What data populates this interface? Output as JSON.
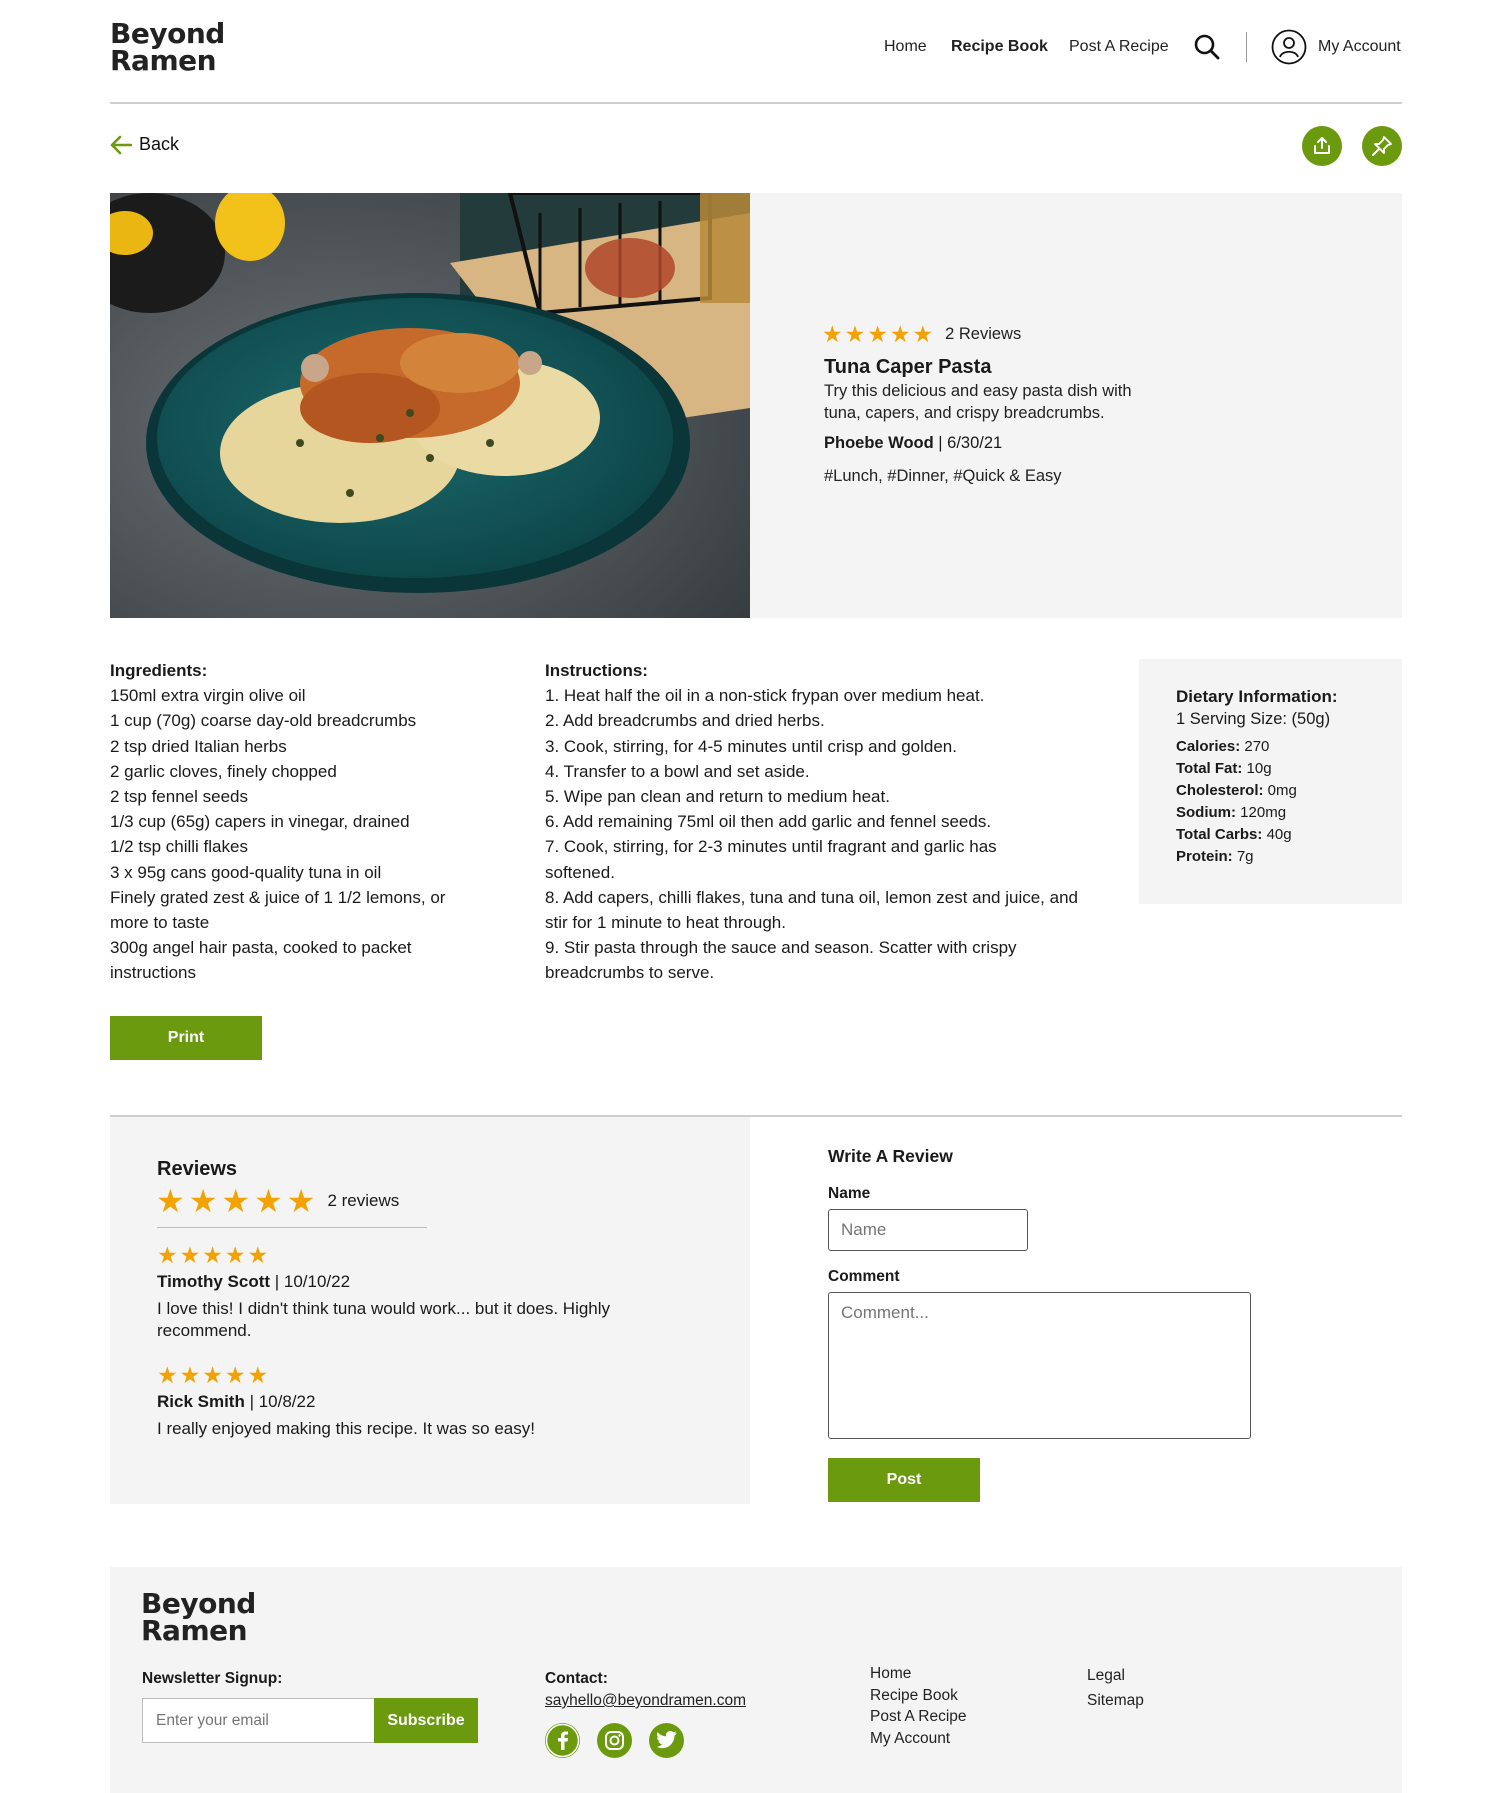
{
  "header": {
    "logo": [
      "Beyond",
      "Ramen"
    ],
    "nav": [
      "Home",
      "Recipe Book",
      "Post A Recipe"
    ],
    "account_label": "My Account"
  },
  "back_label": "Back",
  "recipe": {
    "image_alt": "Tuna caper pasta on a teal plate",
    "stars": "★★★★★",
    "rating": 5,
    "reviews_count": "2 Reviews",
    "title": "Tuna Caper Pasta",
    "description_lines": [
      "Try this delicious and easy pasta dish with",
      "tuna, capers, and crispy breadcrumbs."
    ],
    "author": "Phoebe Wood",
    "date": " | 6/30/21",
    "tags": "#Lunch, #Dinner, #Quick & Easy"
  },
  "ingredients": {
    "heading": "Ingredients:",
    "lines": [
      "150ml extra virgin olive oil",
      "1 cup (70g) coarse day-old breadcrumbs",
      "2 tsp dried Italian herbs",
      "2 garlic cloves, finely chopped",
      "2 tsp fennel seeds",
      "1/3 cup (65g) capers in vinegar, drained",
      "1/2 tsp chilli flakes",
      "3 x 95g cans good-quality tuna in oil",
      "Finely grated zest & juice of 1 1/2 lemons, or",
      "more to taste",
      "300g angel hair pasta, cooked to packet",
      "instructions"
    ]
  },
  "instructions": {
    "heading": "Instructions:",
    "lines": [
      "1. Heat half the oil in a non-stick frypan over medium heat.",
      "2. Add breadcrumbs and dried herbs.",
      "3. Cook, stirring, for 4-5 minutes until crisp and golden.",
      "4. Transfer to a bowl and set aside.",
      "5. Wipe pan clean and return to medium heat.",
      "6. Add remaining 75ml oil then add garlic and fennel seeds.",
      "7. Cook, stirring, for 2-3 minutes until fragrant and garlic has",
      "softened.",
      "8. Add capers, chilli flakes, tuna and tuna oil, lemon zest and juice, and",
      "stir for 1 minute to heat through.",
      "9. Stir pasta through the sauce and season. Scatter with crispy",
      "breadcrumbs to serve."
    ]
  },
  "dietary": {
    "heading": "Dietary Information:",
    "serving": "1 Serving Size: (50g)",
    "rows": [
      {
        "label": "Calories:",
        "value": " 270"
      },
      {
        "label": "Total Fat:",
        "value": " 10g"
      },
      {
        "label": "Cholesterol:",
        "value": " 0mg"
      },
      {
        "label": "Sodium:",
        "value": " 120mg"
      },
      {
        "label": "Total Carbs:",
        "value": " 40g"
      },
      {
        "label": "Protein:",
        "value": " 7g"
      }
    ]
  },
  "print_label": "Print",
  "reviews": {
    "heading": "Reviews",
    "stars": "★★★★★",
    "count": "2 reviews",
    "items": [
      {
        "stars": "★★★★★",
        "rating": 5,
        "name": "Timothy Scott",
        "date": " | 10/10/22",
        "lines": [
          "I love this! I didn't think tuna would work... but it does. Highly",
          "recommend."
        ]
      },
      {
        "stars": "★★★★★",
        "rating": 5,
        "name": "Rick Smith",
        "date": " | 10/8/22",
        "lines": [
          "I really enjoyed making this recipe. It was so easy!"
        ]
      }
    ]
  },
  "write_review": {
    "heading": "Write A Review",
    "name_label": "Name",
    "name_placeholder": "Name",
    "comment_label": "Comment",
    "comment_placeholder": "Comment...",
    "post_label": "Post"
  },
  "footer": {
    "logo": [
      "Beyond",
      "Ramen"
    ],
    "newsletter_label": "Newsletter Signup:",
    "email_placeholder": "Enter your email",
    "subscribe_label": "Subscribe",
    "contact_label": "Contact:",
    "contact_email": "sayhello@beyondramen.com",
    "links_1": [
      "Home",
      "Recipe Book",
      "Post A Recipe",
      "My Account"
    ],
    "links_2": [
      "Legal",
      "Sitemap"
    ]
  },
  "colors": {
    "accent": "#6b9a0f",
    "star": "#f2a202",
    "panel": "#f4f4f4"
  }
}
